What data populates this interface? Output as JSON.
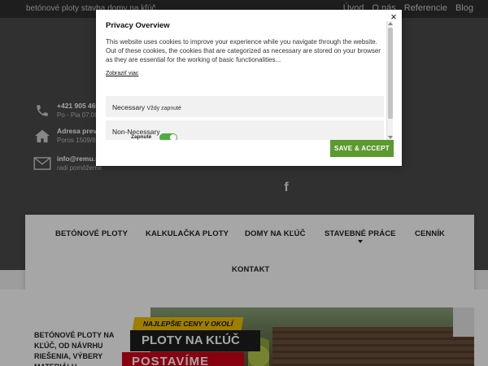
{
  "topbar": {
    "tagline": "betónové ploty stavba domy na kľúč",
    "links": [
      "Úvod",
      "O nás",
      "Referencie",
      "Blog"
    ]
  },
  "contact": {
    "phone_line1": "+421 905 469 6",
    "phone_line2": "Po - Pia 07:00 -",
    "address_line1": "Adresa prevá",
    "address_line2": "Poros 1509/8",
    "email_line1": "info@remu.s",
    "email_line2": "radi pomôžeme"
  },
  "social": {
    "facebook_glyph": "f"
  },
  "nav": {
    "items": [
      "BETÓNOVÉ PLOTY",
      "KALKULAČKA PLOTY",
      "DOMY NA KĽÚČ",
      "STAVEBNÉ PRÁCE",
      "CENNÍK",
      "KONTAKT"
    ]
  },
  "hero": {
    "intro": "BETÓNOVÉ PLOTY NA KĽÚČ, OD NÁVRHU RIEŠENIA, VÝBERY MATERIÁLU",
    "tag": "NAJLEPŠIE CENY V OKOLÍ",
    "headline": "PLOTY NA KĽÚČ",
    "subheadline": "POSTAVÍME"
  },
  "cookie": {
    "close_glyph": "×",
    "title": "Privacy Overview",
    "description": "This website uses cookies to improve your experience while you navigate through the website. Out of these cookies, the cookies that are categorized as necessary are stored on your browser as they are essential for the working of basic functionalities...",
    "more_link": "Zobraziť viac",
    "necessary_label": "Necessary",
    "necessary_status": "Vždy zapnuté",
    "nonnecessary_label": "Non-Necessary",
    "toggle_label": "Zapnuté",
    "accept_label": "SAVE & ACCEPT"
  },
  "colors": {
    "accent_green": "#5b9a2f",
    "toggle_green": "#4cae3e",
    "header_dark": "#4a4a4a",
    "banner_red": "#d0021b",
    "tag_yellow": "#f2c200"
  }
}
